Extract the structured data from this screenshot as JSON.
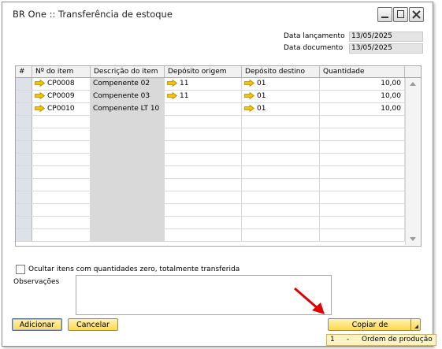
{
  "window": {
    "title": "BR One :: Transferência de estoque"
  },
  "header_fields": [
    {
      "label": "Data lançamento",
      "value": "13/05/2025"
    },
    {
      "label": "Data documento",
      "value": "13/05/2025"
    }
  ],
  "grid": {
    "columns": [
      "#",
      "Nº do item",
      "Descrição do item",
      "Depósito origem",
      "Depósito destino",
      "Quantidade"
    ],
    "rows": [
      {
        "item": "CP0008",
        "description": "Compenente 02",
        "origin": "11",
        "destination": "01",
        "quantity": "10,00"
      },
      {
        "item": "CP0009",
        "description": "Compenente 03",
        "origin": "11",
        "destination": "01",
        "quantity": "10,00"
      },
      {
        "item": "CP0010",
        "description": "Compenente LT 10",
        "origin": "",
        "destination": "01",
        "quantity": "10,00"
      }
    ]
  },
  "options": {
    "hide_zero_label": "Ocultar itens com quantidades zero, totalmente transferida"
  },
  "remarks": {
    "label": "Observações",
    "value": ""
  },
  "buttons": {
    "add": "Adicionar",
    "cancel": "Cancelar",
    "copy_from": "Copiar de"
  },
  "copy_menu": {
    "items": [
      {
        "number": "1",
        "sep": "-",
        "text": "Ordem de produção"
      }
    ]
  },
  "colors": {
    "button": "#ffd94a",
    "link_arrow": "#f5c400",
    "callout_arrow": "#e00000",
    "row_header": "#dde2e8"
  }
}
